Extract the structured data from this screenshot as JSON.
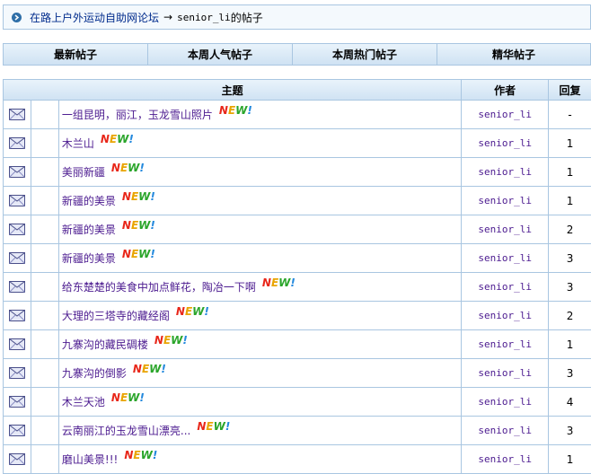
{
  "breadcrumb": {
    "forum_link": "在路上户外运动自助网论坛",
    "separator": "→",
    "user": "senior_li",
    "suffix": " 的帖子"
  },
  "tabs": [
    {
      "label": "最新帖子"
    },
    {
      "label": "本周人气帖子"
    },
    {
      "label": "本周热门帖子"
    },
    {
      "label": "精华帖子"
    }
  ],
  "table": {
    "headers": {
      "subject": "主题",
      "author": "作者",
      "replies": "回复"
    },
    "new_badge": {
      "n": "N",
      "e": "E",
      "w": "W",
      "x": "!"
    },
    "rows": [
      {
        "subject": "一组昆明，丽江，玉龙雪山照片",
        "author": "senior_li",
        "replies": "-"
      },
      {
        "subject": "木兰山",
        "author": "senior_li",
        "replies": "1"
      },
      {
        "subject": "美丽新疆",
        "author": "senior_li",
        "replies": "1"
      },
      {
        "subject": "新疆的美景",
        "author": "senior_li",
        "replies": "1"
      },
      {
        "subject": "新疆的美景",
        "author": "senior_li",
        "replies": "2"
      },
      {
        "subject": "新疆的美景",
        "author": "senior_li",
        "replies": "3"
      },
      {
        "subject": "给东楚楚的美食中加点鲜花，陶冶一下啊",
        "author": "senior_li",
        "replies": "3"
      },
      {
        "subject": "大理的三塔寺的藏经阁",
        "author": "senior_li",
        "replies": "2"
      },
      {
        "subject": "九寨沟的藏民碉楼",
        "author": "senior_li",
        "replies": "1"
      },
      {
        "subject": "九寨沟的倒影",
        "author": "senior_li",
        "replies": "3"
      },
      {
        "subject": "木兰天池",
        "author": "senior_li",
        "replies": "4"
      },
      {
        "subject": "云南丽江的玉龙雪山漂亮...",
        "author": "senior_li",
        "replies": "3"
      },
      {
        "subject": "磨山美景!!!",
        "author": "senior_li",
        "replies": "1"
      }
    ]
  },
  "icons": {
    "row_icon": "envelope-icon",
    "crumb_icon": "arrow-bullet-icon"
  },
  "colors": {
    "border": "#a9c6e1",
    "link": "#4b1a8f",
    "header_bg": "#cfe2f3"
  }
}
